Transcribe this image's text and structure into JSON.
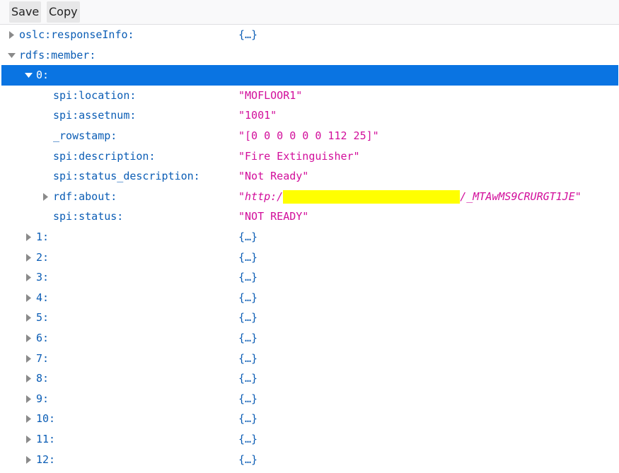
{
  "toolbar": {
    "save_label": "Save",
    "copy_label": "Copy"
  },
  "tree": {
    "response_info": {
      "key": "oslc:responseInfo:",
      "value": "{…}"
    },
    "rdfs_member": {
      "key": "rdfs:member:"
    },
    "member0": {
      "key": "0:",
      "fields": [
        {
          "key": "spi:location:",
          "value": "\"MOFLOOR1\""
        },
        {
          "key": "spi:assetnum:",
          "value": "\"1001\""
        },
        {
          "key": "_rowstamp:",
          "value": "\"[0 0 0 0 0 0 112 25]\""
        },
        {
          "key": "spi:description:",
          "value": "\"Fire Extinguisher\""
        },
        {
          "key": "spi:status_description:",
          "value": "\"Not Ready\""
        }
      ],
      "about": {
        "key": "rdf:about:",
        "prefix": "\"http:/",
        "suffix": "/_MTAwMS9CRURGT1JE\""
      },
      "status": {
        "key": "spi:status:",
        "value": "\"NOT READY\""
      }
    },
    "collapsed_members": [
      {
        "key": "1:",
        "value": "{…}"
      },
      {
        "key": "2:",
        "value": "{…}"
      },
      {
        "key": "3:",
        "value": "{…}"
      },
      {
        "key": "4:",
        "value": "{…}"
      },
      {
        "key": "5:",
        "value": "{…}"
      },
      {
        "key": "6:",
        "value": "{…}"
      },
      {
        "key": "7:",
        "value": "{…}"
      },
      {
        "key": "8:",
        "value": "{…}"
      },
      {
        "key": "9:",
        "value": "{…}"
      },
      {
        "key": "10:",
        "value": "{…}"
      },
      {
        "key": "11:",
        "value": "{…}"
      },
      {
        "key": "12:",
        "value": "{…}"
      }
    ]
  }
}
